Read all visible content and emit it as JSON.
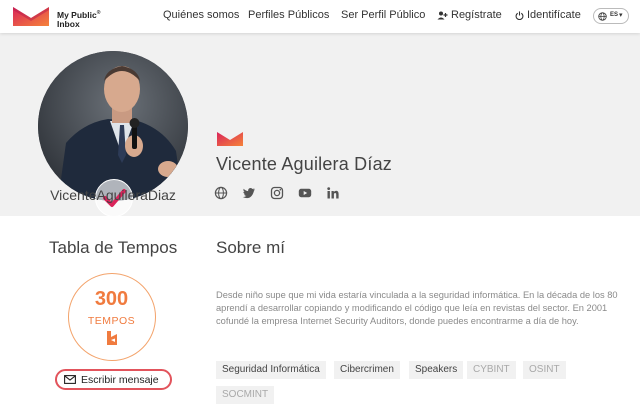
{
  "header": {
    "brand_line1": "My Public",
    "brand_line2": "Inbox",
    "brand_mark": "®",
    "nav": [
      {
        "label": "Quiénes somos"
      },
      {
        "label": "Perfiles Públicos"
      },
      {
        "label": "Ser Perfil Público"
      },
      {
        "label": "Regístrate",
        "icon": "add-user-icon"
      },
      {
        "label": "Identifícate",
        "icon": "power-icon"
      }
    ],
    "language": {
      "code": "ES",
      "icon": "globe-icon"
    }
  },
  "profile": {
    "username": "VicenteAguileraDiaz",
    "full_name": "Vicente Aguilera Díaz",
    "social_icons": [
      "globe-icon",
      "twitter-icon",
      "instagram-icon",
      "youtube-icon",
      "linkedin-icon"
    ]
  },
  "tabla": {
    "title": "Tabla de Tempos",
    "value": "300",
    "label": "TEMPOS",
    "message_button": "Escribir mensaje"
  },
  "about": {
    "title": "Sobre mí",
    "bio": "Desde niño supe que mi vida estaría vinculada a la seguridad informática. En la década de los 80 aprendí a desarrollar copiando y modificando el código que leía en revistas del sector. En 2001 cofundé la empresa Internet Security Auditors, donde puedes encontrarme a día de hoy.",
    "tags": [
      {
        "label": "Seguridad Informática",
        "style": "dark"
      },
      {
        "label": "Cibercrimen",
        "style": "dark"
      },
      {
        "label": "Speakers",
        "style": "dark"
      },
      {
        "label": "CYBINT",
        "style": "light"
      },
      {
        "label": "OSINT",
        "style": "light"
      },
      {
        "label": "SOCMINT",
        "style": "light"
      }
    ]
  },
  "colors": {
    "accent_red": "#e2545c",
    "accent_orange": "#f07b3f",
    "hero_bg": "#f1f1f1"
  }
}
